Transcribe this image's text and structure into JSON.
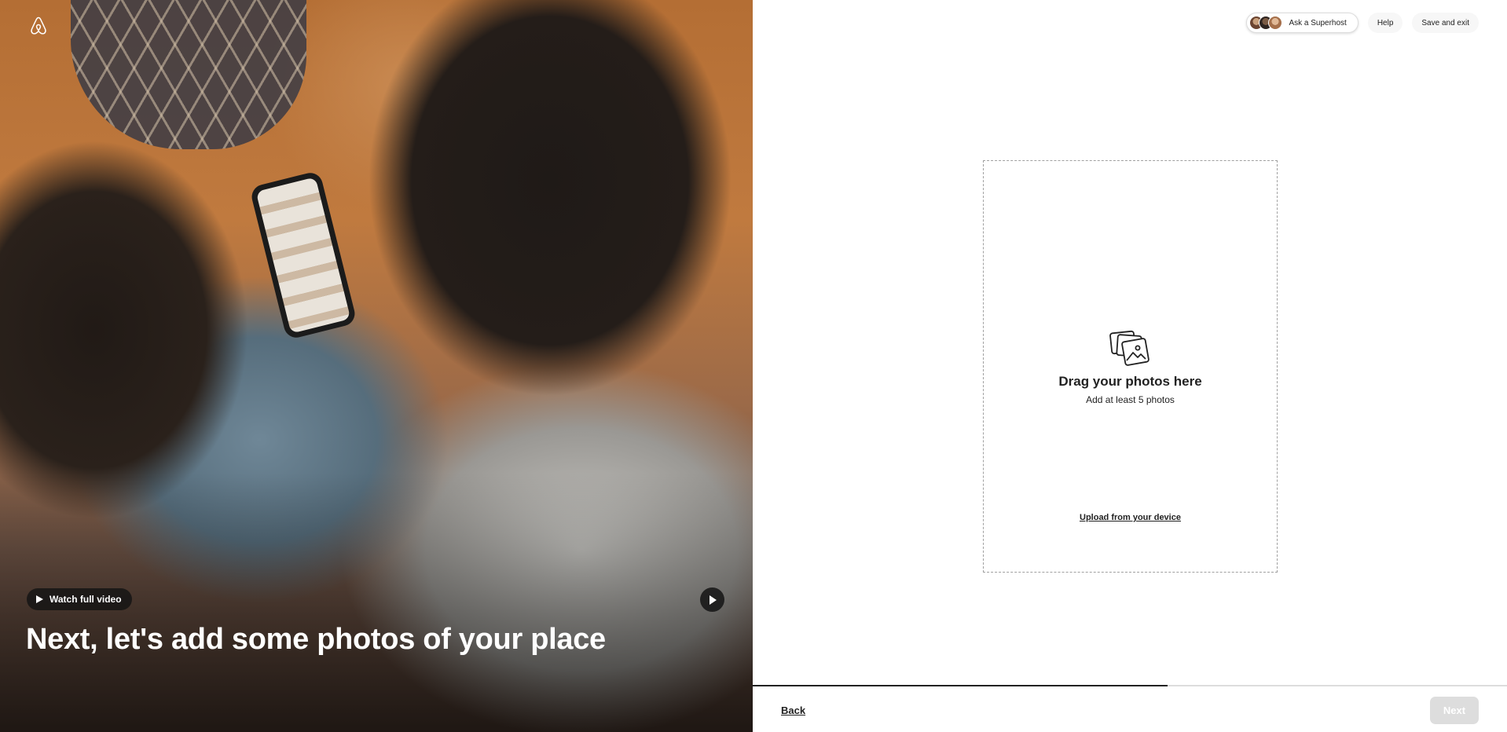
{
  "hero": {
    "watch_label": "Watch full video",
    "title": "Next, let's add some photos of your place"
  },
  "topbar": {
    "superhost_label": "Ask a Superhost",
    "help_label": "Help",
    "save_exit_label": "Save and exit"
  },
  "dropzone": {
    "title": "Drag your photos here",
    "subtitle": "Add at least 5 photos",
    "upload_label": "Upload from your device"
  },
  "footer": {
    "back_label": "Back",
    "next_label": "Next",
    "progress": 0.55
  },
  "colors": {
    "text": "#222222",
    "disabled_button": "#dddddd",
    "dropzone_border": "#a0a0a0"
  },
  "icons": [
    "airbnb-logo-icon",
    "play-icon",
    "photos-icon"
  ]
}
